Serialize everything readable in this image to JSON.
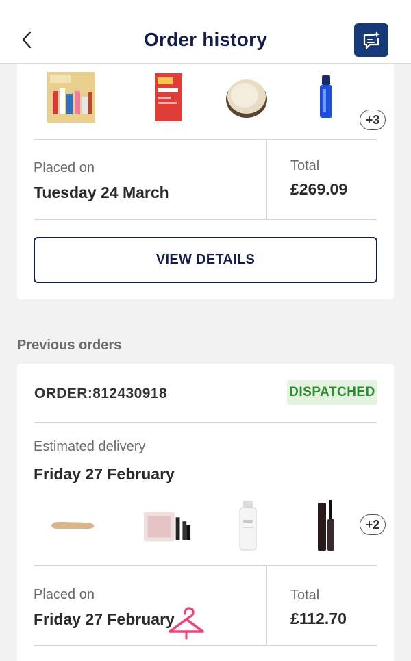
{
  "header": {
    "title": "Order history"
  },
  "current_order": {
    "extra_items_badge": "+3",
    "placed_on_label": "Placed on",
    "placed_on_value": "Tuesday 24 March",
    "total_label": "Total",
    "total_value": "£269.09",
    "view_details_label": "VIEW DETAILS"
  },
  "previous_orders": {
    "section_title": "Previous orders",
    "order": {
      "order_label": "ORDER:812430918",
      "status": "DISPATCHED",
      "estimated_delivery_label": "Estimated delivery",
      "estimated_delivery_value": "Friday 27 February",
      "extra_items_badge": "+2",
      "placed_on_label": "Placed on",
      "placed_on_value": "Friday 27 February",
      "total_label": "Total",
      "total_value": "£112.70"
    }
  },
  "colors": {
    "brand_navy": "#151e4a",
    "chat_button": "#16397a",
    "dispatched_bg": "#e4f2e0",
    "dispatched_text": "#2d8a2d",
    "hanger_pink": "#e8467c"
  },
  "icons": [
    "back-chevron-icon",
    "chat-sparkle-icon",
    "hanger-icon"
  ]
}
